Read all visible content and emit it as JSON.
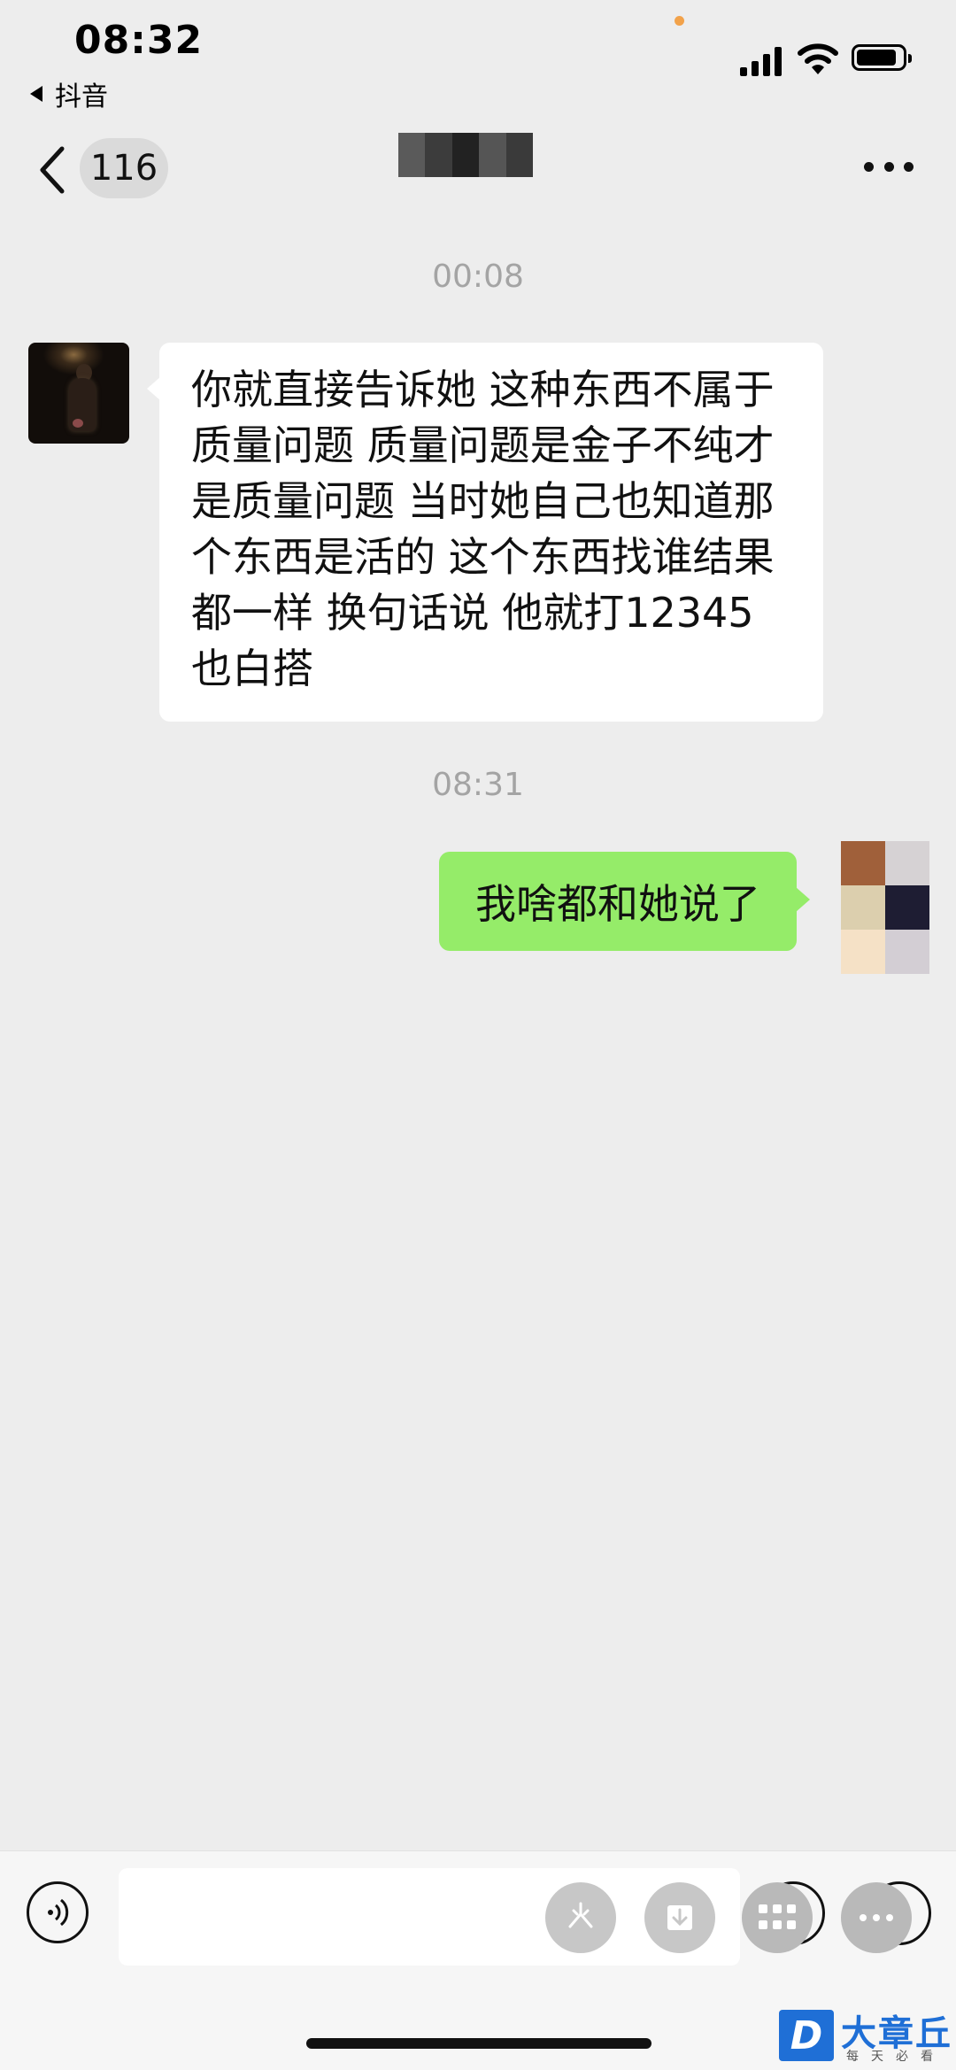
{
  "status_bar": {
    "time": "08:32",
    "back_app": "抖音"
  },
  "nav": {
    "unread_count": "116"
  },
  "messages": [
    {
      "timestamp": "00:08",
      "side": "left",
      "text": "你就直接告诉她 这种东西不属于质量问题 质量问题是金子不纯才是质量问题 当时她自己也知道那个东西是活的 这个东西找谁结果都一样 换句话说 他就打12345也白搭"
    },
    {
      "timestamp": "08:31",
      "side": "right",
      "text": "我啥都和她说了"
    }
  ],
  "colors": {
    "background": "#ededed",
    "sent_bubble": "#95ec69",
    "received_bubble": "#ffffff",
    "timestamp": "#a4a4a4"
  },
  "icons": {
    "input_bar": [
      "voice-icon",
      "emoji-icon",
      "plus-icon",
      "sparkle-icon",
      "download-icon",
      "grid-icon",
      "more-horizontal-icon"
    ]
  },
  "watermark": {
    "logo": "D",
    "name": "大章丘",
    "tagline": "每天必看"
  }
}
